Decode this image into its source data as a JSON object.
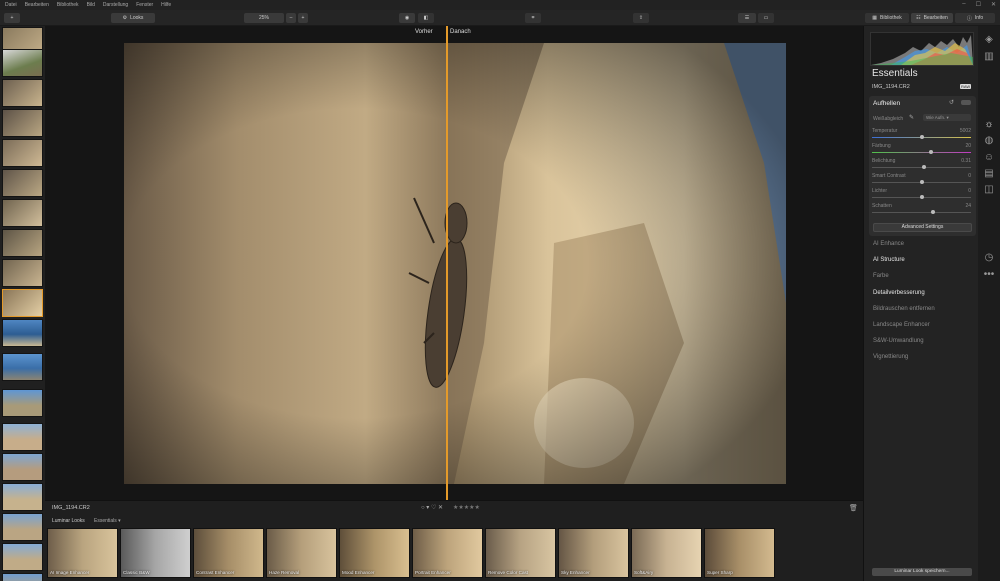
{
  "menu": [
    "Datei",
    "Bearbeiten",
    "Bibliothek",
    "Bild",
    "Darstellung",
    "Fenster",
    "Hilfe"
  ],
  "window_controls": [
    "–",
    "☐",
    "✕"
  ],
  "toolbar": {
    "add_label": "+",
    "looks_label": "Looks",
    "zoom_value": "25%",
    "zoom_out": "–",
    "zoom_in": "+",
    "tab_library": "Bibliothek",
    "tab_edit": "Bearbeiten",
    "tab_info": "Info"
  },
  "viewer": {
    "before_label": "Vorher",
    "after_label": "Danach"
  },
  "infobar": {
    "filename": "IMG_1194.CR2",
    "rating_flags": "○ ▾   ♡   ✕",
    "stars": "★★★★★"
  },
  "looks": {
    "tab_luminar": "Luminar Looks",
    "tab_essentials": "Essentials",
    "items": [
      "AI Image Enhancer",
      "Classic B&W",
      "Contrast Enhancer",
      "Haze Removal",
      "Mood Enhancer",
      "Portrait Enhancer",
      "Remove Color Cast",
      "Sky Enhancer",
      "Soft&Airy",
      "Super Sharp"
    ]
  },
  "panel": {
    "title": "Essentials",
    "filename": "IMG_1194.CR2",
    "raw_badge": "RAW",
    "group_title": "Aufhellen",
    "wb_label": "Weißabgleich",
    "wb_value": "Wie Aufn.",
    "sliders": [
      {
        "label": "Temperatur",
        "value": "5002",
        "pos": 0.5
      },
      {
        "label": "Färbung",
        "value": "20",
        "pos": 0.6
      },
      {
        "label": "Belichtung",
        "value": "0.31",
        "pos": 0.53
      },
      {
        "label": "Smart Contrast",
        "value": "0",
        "pos": 0.5
      },
      {
        "label": "Lichter",
        "value": "0",
        "pos": 0.5
      },
      {
        "label": "Schatten",
        "value": "24",
        "pos": 0.62
      }
    ],
    "advanced_button": "Advanced Settings",
    "sections": [
      "AI Enhance",
      "AI Structure",
      "Farbe",
      "Detailverbesserung",
      "Bildrauschen entfernen",
      "Landscape Enhancer",
      "S&W-Umwandlung",
      "Vignettierung"
    ],
    "save_button": "Luminar Look speichern..."
  },
  "colors": {
    "accent": "#e49a2a",
    "panel_bg": "#232323"
  }
}
